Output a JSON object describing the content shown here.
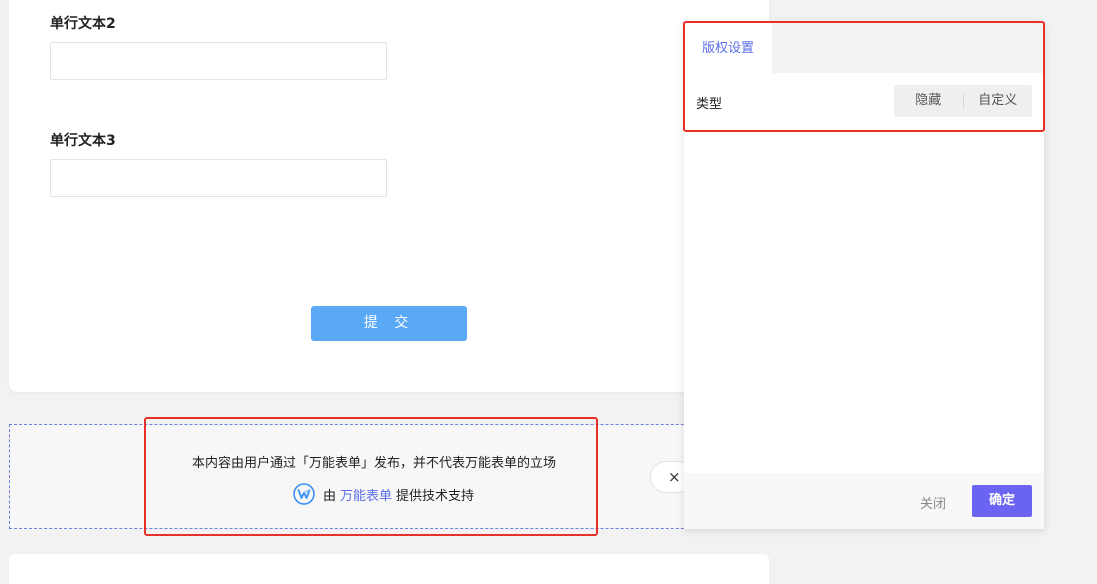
{
  "form": {
    "fields": [
      {
        "label": "单行文本2",
        "value": ""
      },
      {
        "label": "单行文本3",
        "value": ""
      }
    ],
    "submit_label": "提 交"
  },
  "copyright": {
    "statement": "本内容由用户通过「万能表单」发布，并不代表万能表单的立场",
    "powered_prefix": "由",
    "brand_name": "万能表单",
    "powered_suffix": "提供技术支持",
    "close_glyph": "×"
  },
  "panel": {
    "tab_label": "版权设置",
    "type_label": "类型",
    "type_options": [
      "隐藏",
      "自定义"
    ],
    "close_label": "关闭",
    "confirm_label": "确定"
  },
  "colors": {
    "accent": "#6b64f2",
    "link": "#5b6ee8",
    "submit": "#5aa9f7",
    "annotation": "#e8302a"
  },
  "icons": {
    "brand": "brand-logo-icon",
    "close": "close-icon"
  }
}
